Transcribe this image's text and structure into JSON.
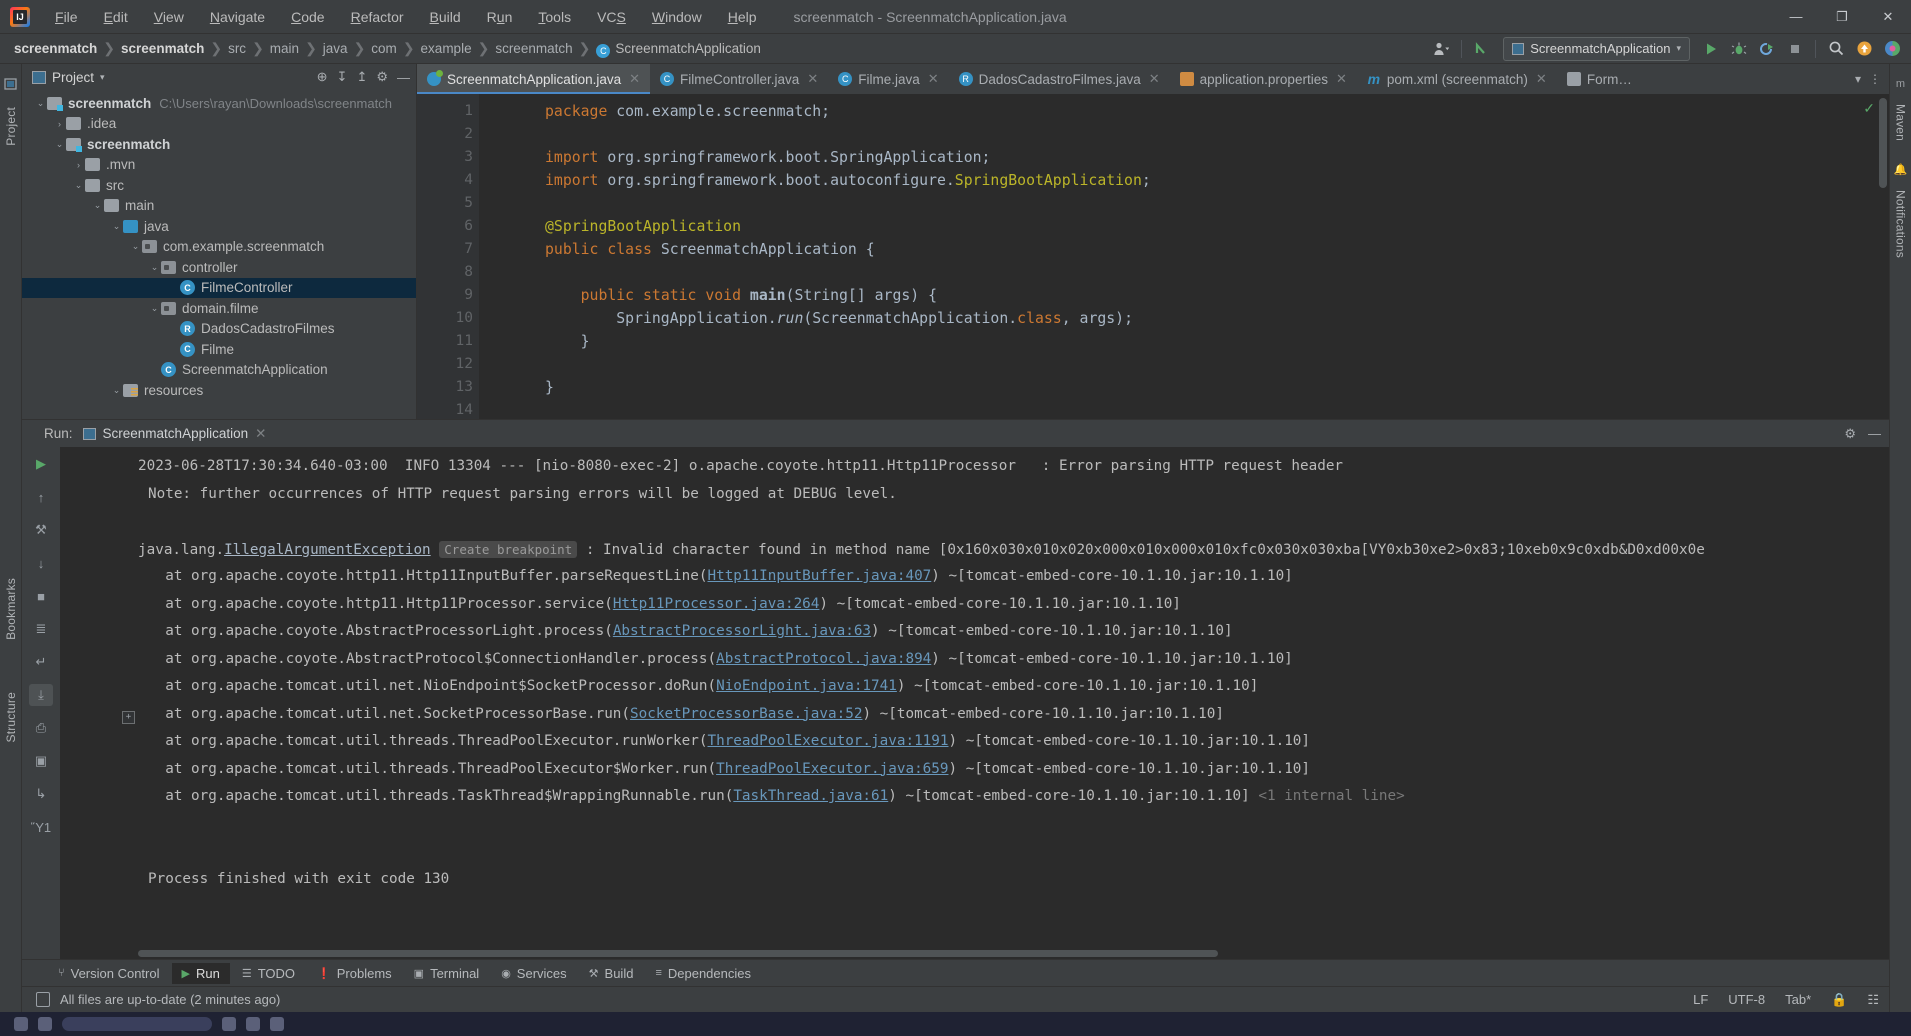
{
  "window": {
    "title": "screenmatch - ScreenmatchApplication.java",
    "logo_icon": "intellij-idea-logo",
    "controls": {
      "minimize": "—",
      "maximize": "❐",
      "close": "✕"
    }
  },
  "menu": [
    {
      "label": "File",
      "mnemonic": "F"
    },
    {
      "label": "Edit",
      "mnemonic": "E"
    },
    {
      "label": "View",
      "mnemonic": "V"
    },
    {
      "label": "Navigate",
      "mnemonic": "N"
    },
    {
      "label": "Code",
      "mnemonic": "C"
    },
    {
      "label": "Refactor",
      "mnemonic": "R"
    },
    {
      "label": "Build",
      "mnemonic": "B"
    },
    {
      "label": "Run",
      "mnemonic": "u"
    },
    {
      "label": "Tools",
      "mnemonic": "T"
    },
    {
      "label": "VCS",
      "mnemonic": "S"
    },
    {
      "label": "Window",
      "mnemonic": "W"
    },
    {
      "label": "Help",
      "mnemonic": "H"
    }
  ],
  "breadcrumb": {
    "items": [
      {
        "label": "screenmatch",
        "style": "bold"
      },
      {
        "label": "screenmatch",
        "style": "bold"
      },
      {
        "label": "src",
        "style": "dim"
      },
      {
        "label": "main",
        "style": "dim"
      },
      {
        "label": "java",
        "style": "dim"
      },
      {
        "label": "com",
        "style": "dim"
      },
      {
        "label": "example",
        "style": "dim"
      },
      {
        "label": "screenmatch",
        "style": "dim"
      },
      {
        "label": "ScreenmatchApplication",
        "style": "class",
        "icon": "class-icon"
      }
    ],
    "separator": "❯"
  },
  "navbar_right": {
    "account_icon": "user-avatar-icon",
    "account_chevron": "▾",
    "vcs_update_icon": "vcs-arrow-icon",
    "run_config": {
      "label": "ScreenmatchApplication",
      "icon": "run-config-icon",
      "chevron": "▾"
    },
    "run_icon": "run-play-icon",
    "debug_icon": "debug-bug-icon",
    "coverage_icon": "run-with-coverage-icon",
    "stop_icon": "stop-icon",
    "search_icon": "search-everywhere-icon",
    "updates_icon": "update-available-icon",
    "ai_icon": "ai-assistant-icon"
  },
  "left_strip": {
    "project_label": "Project",
    "bookmarks_label": "Bookmarks",
    "structure_label": "Structure",
    "bottom_icon": "terminal-icon"
  },
  "right_strip": {
    "maven_label": "Maven",
    "notifications_label": "Notifications",
    "bell_icon": "notifications-bell-icon",
    "maven_icon": "maven-icon"
  },
  "project_panel": {
    "title": "Project",
    "title_chevron": "▾",
    "icon": "project-view-icon",
    "toolbar": [
      {
        "name": "select-opened-file-icon",
        "glyph": "⊕"
      },
      {
        "name": "collapse-all-icon",
        "glyph": "↧"
      },
      {
        "name": "expand-all-icon",
        "glyph": "↥"
      },
      {
        "name": "settings-gear-icon",
        "glyph": "⚙"
      },
      {
        "name": "hide-icon",
        "glyph": "—"
      }
    ],
    "tree": [
      {
        "depth": 0,
        "twist": "⌄",
        "icon": "module-folder-icon",
        "iconclass": "fico mod",
        "label": "screenmatch",
        "bold": true,
        "path": "C:\\Users\\rayan\\Downloads\\screenmatch"
      },
      {
        "depth": 1,
        "twist": "›",
        "icon": "folder-icon",
        "iconclass": "fico",
        "label": ".idea",
        "bold": false,
        "path": ""
      },
      {
        "depth": 1,
        "twist": "⌄",
        "icon": "module-folder-icon",
        "iconclass": "fico mod",
        "label": "screenmatch",
        "bold": true,
        "path": ""
      },
      {
        "depth": 2,
        "twist": "›",
        "icon": "folder-icon",
        "iconclass": "fico",
        "label": ".mvn",
        "bold": false,
        "path": ""
      },
      {
        "depth": 2,
        "twist": "⌄",
        "icon": "folder-icon",
        "iconclass": "fico",
        "label": "src",
        "bold": false,
        "path": ""
      },
      {
        "depth": 3,
        "twist": "⌄",
        "icon": "folder-icon",
        "iconclass": "fico",
        "label": "main",
        "bold": false,
        "path": ""
      },
      {
        "depth": 4,
        "twist": "⌄",
        "icon": "source-root-folder-icon",
        "iconclass": "fico src",
        "label": "java",
        "bold": false,
        "path": ""
      },
      {
        "depth": 5,
        "twist": "⌄",
        "icon": "package-icon",
        "iconclass": "fico pkg",
        "label": "com.example.screenmatch",
        "bold": false,
        "path": ""
      },
      {
        "depth": 6,
        "twist": "⌄",
        "icon": "package-icon",
        "iconclass": "fico pkg",
        "label": "controller",
        "bold": false,
        "path": ""
      },
      {
        "depth": 7,
        "twist": "",
        "icon": "class-icon",
        "iconclass": "cico",
        "iconglyph": "C",
        "label": "FilmeController",
        "bold": false,
        "path": "",
        "selected": true
      },
      {
        "depth": 6,
        "twist": "⌄",
        "icon": "package-icon",
        "iconclass": "fico pkg",
        "label": "domain.filme",
        "bold": false,
        "path": ""
      },
      {
        "depth": 7,
        "twist": "",
        "icon": "record-icon",
        "iconclass": "cico rec",
        "iconglyph": "R",
        "label": "DadosCadastroFilmes",
        "bold": false,
        "path": ""
      },
      {
        "depth": 7,
        "twist": "",
        "icon": "class-icon",
        "iconclass": "cico",
        "iconglyph": "C",
        "label": "Filme",
        "bold": false,
        "path": ""
      },
      {
        "depth": 6,
        "twist": "",
        "icon": "spring-boot-class-icon",
        "iconclass": "cico",
        "iconglyph": "C",
        "label": "ScreenmatchApplication",
        "bold": false,
        "path": ""
      },
      {
        "depth": 4,
        "twist": "⌄",
        "icon": "resources-folder-icon",
        "iconclass": "fico res",
        "label": "resources",
        "bold": false,
        "path": ""
      }
    ]
  },
  "editor": {
    "tabs": [
      {
        "label": "ScreenmatchApplication.java",
        "icon": "spring-class-icon",
        "iconclass": "tabico spring",
        "active": true,
        "close": "✕"
      },
      {
        "label": "FilmeController.java",
        "icon": "class-icon",
        "iconclass": "tabico",
        "iconglyph": "C",
        "active": false,
        "close": "✕"
      },
      {
        "label": "Filme.java",
        "icon": "class-icon",
        "iconclass": "tabico",
        "iconglyph": "C",
        "active": false,
        "close": "✕"
      },
      {
        "label": "DadosCadastroFilmes.java",
        "icon": "record-icon",
        "iconclass": "tabico rec",
        "iconglyph": "R",
        "active": false,
        "close": "✕"
      },
      {
        "label": "application.properties",
        "icon": "properties-file-icon",
        "iconclass": "tabico props",
        "active": false,
        "close": "✕"
      },
      {
        "label": "pom.xml (screenmatch)",
        "icon": "maven-pom-icon",
        "iconclass": "tabico mvn",
        "iconglyph": "m",
        "active": false,
        "close": "✕"
      },
      {
        "label": "Form…",
        "icon": "form-file-icon",
        "iconclass": "tabico form",
        "active": false,
        "close": ""
      }
    ],
    "tab_overflow_icon": "chevron-down-icon",
    "tab_more_icon": "more-vertical-icon",
    "inspection_status_icon": "inspections-ok-icon",
    "lines": [
      {
        "n": 1,
        "html": "<span class=\"kw\">package</span> com.example.screenmatch;",
        "run_mark": false,
        "fold": ""
      },
      {
        "n": 2,
        "html": "",
        "run_mark": false,
        "fold": ""
      },
      {
        "n": 3,
        "html": "<span class=\"kw\">import</span> org.springframework.boot.SpringApplication;",
        "run_mark": false,
        "fold": "▽"
      },
      {
        "n": 4,
        "html": "<span class=\"kw\">import</span> org.springframework.boot.autoconfigure.<span class=\"gold\">SpringBootApplication</span>;",
        "run_mark": false,
        "fold": "△"
      },
      {
        "n": 5,
        "html": "",
        "run_mark": false,
        "fold": ""
      },
      {
        "n": 6,
        "html": "<span class=\"ann\">@SpringBootApplication</span>",
        "run_mark": false,
        "fold": ""
      },
      {
        "n": 7,
        "html": "<span class=\"kw\">public class</span> ScreenmatchApplication {",
        "run_mark": true,
        "fold": ""
      },
      {
        "n": 8,
        "html": "",
        "run_mark": false,
        "fold": ""
      },
      {
        "n": 9,
        "html": "    <span class=\"kw\">public static void</span> <span class=\"bold-w\">main</span>(String[] args) {",
        "run_mark": true,
        "fold": "▽"
      },
      {
        "n": 10,
        "html": "        SpringApplication.<span class=\"fn-it\">run</span>(ScreenmatchApplication.<span class=\"kw\">class</span>, args);",
        "run_mark": false,
        "fold": ""
      },
      {
        "n": 11,
        "html": "    }",
        "run_mark": false,
        "fold": "△"
      },
      {
        "n": 12,
        "html": "",
        "run_mark": false,
        "fold": ""
      },
      {
        "n": 13,
        "html": "}",
        "run_mark": false,
        "fold": ""
      },
      {
        "n": 14,
        "html": "",
        "run_mark": false,
        "fold": ""
      }
    ]
  },
  "run_panel": {
    "label": "Run:",
    "tab_label": "ScreenmatchApplication",
    "tab_icon": "run-config-icon",
    "tab_close": "✕",
    "settings_icon": "settings-gear-icon",
    "hide_icon": "hide-icon",
    "tools": [
      {
        "name": "rerun-icon",
        "glyph": "▶",
        "cls": "rt green"
      },
      {
        "name": "scroll-up-icon",
        "glyph": "↑",
        "cls": "rt"
      },
      {
        "name": "wrench-icon",
        "glyph": "⚒",
        "cls": "rt"
      },
      {
        "name": "scroll-down-icon",
        "glyph": "↓",
        "cls": "rt"
      },
      {
        "name": "stop-icon",
        "glyph": "■",
        "cls": "rt"
      },
      {
        "name": "filter-icon",
        "glyph": "≣",
        "cls": "rt"
      },
      {
        "name": "soft-wrap-icon",
        "glyph": "↵",
        "cls": "rt"
      },
      {
        "name": "scroll-to-end-icon",
        "glyph": "⤓",
        "cls": "rt sel"
      },
      {
        "name": "print-icon",
        "glyph": "⎙",
        "cls": "rt"
      },
      {
        "name": "camera-icon",
        "glyph": "▣",
        "cls": "rt"
      },
      {
        "name": "export-icon",
        "glyph": "↳",
        "cls": "rt"
      },
      {
        "name": "trash-icon",
        "glyph": "Ὕ1",
        "cls": "rt"
      }
    ],
    "console_lines": [
      {
        "indent": 0,
        "html": "2023-06-28T17:30:34.640-03:00  INFO 13304 --- [nio-8080-exec-2] o.apache.coyote.http11.Http11Processor   : Error parsing HTTP request header"
      },
      {
        "indent": 1,
        "html": "Note: further occurrences of HTTP request parsing errors will be logged at DEBUG level."
      },
      {
        "indent": 0,
        "html": ""
      },
      {
        "indent": 0,
        "html": "java.lang.<span class=\"err-link\">IllegalArgumentException</span> <span class=\"brk\">Create breakpoint</span> : Invalid character found in method name [0x160x030x010x020x000x010x000x010xfc0x030x030xba[VY0xb30xe2&gt;0x83;10xeb0x9c0xdb&amp;D0xd00x0e"
      },
      {
        "indent": 1,
        "html": "  at org.apache.coyote.http11.Http11InputBuffer.parseRequestLine(<span class=\"lnk\">Http11InputBuffer.java:407</span>) ~[tomcat-embed-core-10.1.10.jar:10.1.10]"
      },
      {
        "indent": 1,
        "html": "  at org.apache.coyote.http11.Http11Processor.service(<span class=\"lnk\">Http11Processor.java:264</span>) ~[tomcat-embed-core-10.1.10.jar:10.1.10]"
      },
      {
        "indent": 1,
        "html": "  at org.apache.coyote.AbstractProcessorLight.process(<span class=\"lnk\">AbstractProcessorLight.java:63</span>) ~[tomcat-embed-core-10.1.10.jar:10.1.10]"
      },
      {
        "indent": 1,
        "html": "  at org.apache.coyote.AbstractProtocol$ConnectionHandler.process(<span class=\"lnk\">AbstractProtocol.java:894</span>) ~[tomcat-embed-core-10.1.10.jar:10.1.10]"
      },
      {
        "indent": 1,
        "html": "  at org.apache.tomcat.util.net.NioEndpoint$SocketProcessor.doRun(<span class=\"lnk\">NioEndpoint.java:1741</span>) ~[tomcat-embed-core-10.1.10.jar:10.1.10]"
      },
      {
        "indent": 1,
        "html": "  at org.apache.tomcat.util.net.SocketProcessorBase.run(<span class=\"lnk\">SocketProcessorBase.java:52</span>) ~[tomcat-embed-core-10.1.10.jar:10.1.10]"
      },
      {
        "indent": 1,
        "html": "  at org.apache.tomcat.util.threads.ThreadPoolExecutor.runWorker(<span class=\"lnk\">ThreadPoolExecutor.java:1191</span>) ~[tomcat-embed-core-10.1.10.jar:10.1.10]"
      },
      {
        "indent": 1,
        "html": "  at org.apache.tomcat.util.threads.ThreadPoolExecutor$Worker.run(<span class=\"lnk\">ThreadPoolExecutor.java:659</span>) ~[tomcat-embed-core-10.1.10.jar:10.1.10]"
      },
      {
        "indent": 1,
        "html": "  at org.apache.tomcat.util.threads.TaskThread$WrappingRunnable.run(<span class=\"lnk\">TaskThread.java:61</span>) ~[tomcat-embed-core-10.1.10.jar:10.1.10] <span class=\"dim2\">&lt;1 internal line&gt;</span>"
      },
      {
        "indent": 0,
        "html": ""
      },
      {
        "indent": 0,
        "html": ""
      },
      {
        "indent": 1,
        "html": "Process finished with exit code 130"
      }
    ],
    "fold_marker": "+"
  },
  "bottom_bar": [
    {
      "label": "Version Control",
      "icon": "version-control-branch-icon",
      "glyph": "⑂",
      "active": false
    },
    {
      "label": "Run",
      "icon": "run-play-icon",
      "glyph": "▶",
      "active": true,
      "green": true
    },
    {
      "label": "TODO",
      "icon": "todo-list-icon",
      "glyph": "☰",
      "active": false
    },
    {
      "label": "Problems",
      "icon": "problems-warning-icon",
      "glyph": "❗",
      "active": false
    },
    {
      "label": "Terminal",
      "icon": "terminal-icon",
      "glyph": "▣",
      "active": false
    },
    {
      "label": "Services",
      "icon": "services-icon",
      "glyph": "◉",
      "active": false
    },
    {
      "label": "Build",
      "icon": "build-hammer-icon",
      "glyph": "⚒",
      "active": false
    },
    {
      "label": "Dependencies",
      "icon": "dependencies-icon",
      "glyph": "≡",
      "active": false
    }
  ],
  "status_bar": {
    "icon": "file-sync-icon",
    "message": "All files are up-to-date (2 minutes ago)",
    "line_separator": "LF",
    "encoding": "UTF-8",
    "indent": "Tab*",
    "lock_icon": "read-only-lock-icon",
    "inspection_icon": "inspections-widget-icon"
  }
}
